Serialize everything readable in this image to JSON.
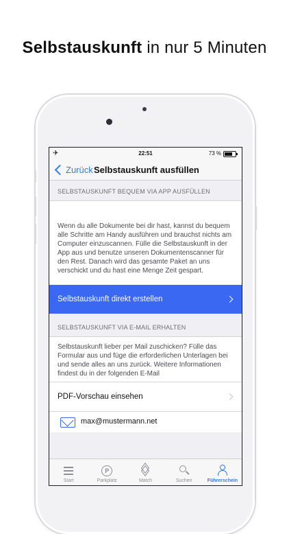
{
  "promo": {
    "bold": "Selbstauskunft",
    "rest": " in nur 5 Minuten"
  },
  "status": {
    "time": "22:51",
    "battery": "73 %"
  },
  "nav": {
    "back_label": "Zurück",
    "title": "Selbstauskunft ausfüllen"
  },
  "sections": {
    "app_header": "SELBSTAUSKUNFT BEQUEM VIA APP AUSFÜLLEN",
    "app_text": "Wenn du alle Dokumente bei dir hast, kannst du bequem alle Schritte am Handy ausführen und brauchst nichts am Computer einzuscannen. Fülle die Selbstauskunft in der App aus und benutze unseren Dokumentenscanner für den Rest. Danach wird das gesamte Paket an uns verschickt und du hast eine Menge Zeit gespart.",
    "create_button": "Selbstauskunft direkt erstellen",
    "mail_header": "SELBSTAUSKUNFT VIA E-MAIL ERHALTEN",
    "mail_text": "Selbstauskunft lieber per Mail zuschicken? Fülle das Formular aus und füge die erforderlichen Unterlagen bei und sende alles an uns zurück. Weitere Informationen findest du in der folgenden E-Mail",
    "pdf_preview": "PDF-Vorschau einsehen",
    "email": "max@mustermann.net"
  },
  "tabs": [
    {
      "label": "Start",
      "icon": "menu-icon"
    },
    {
      "label": "Parkplatz",
      "icon": "parking-icon"
    },
    {
      "label": "Match",
      "icon": "layers-icon"
    },
    {
      "label": "Suchen",
      "icon": "search-icon"
    },
    {
      "label": "Führerschein",
      "icon": "user-icon"
    }
  ],
  "colors": {
    "accent": "#2f7cf6",
    "button": "#3a68f3"
  }
}
